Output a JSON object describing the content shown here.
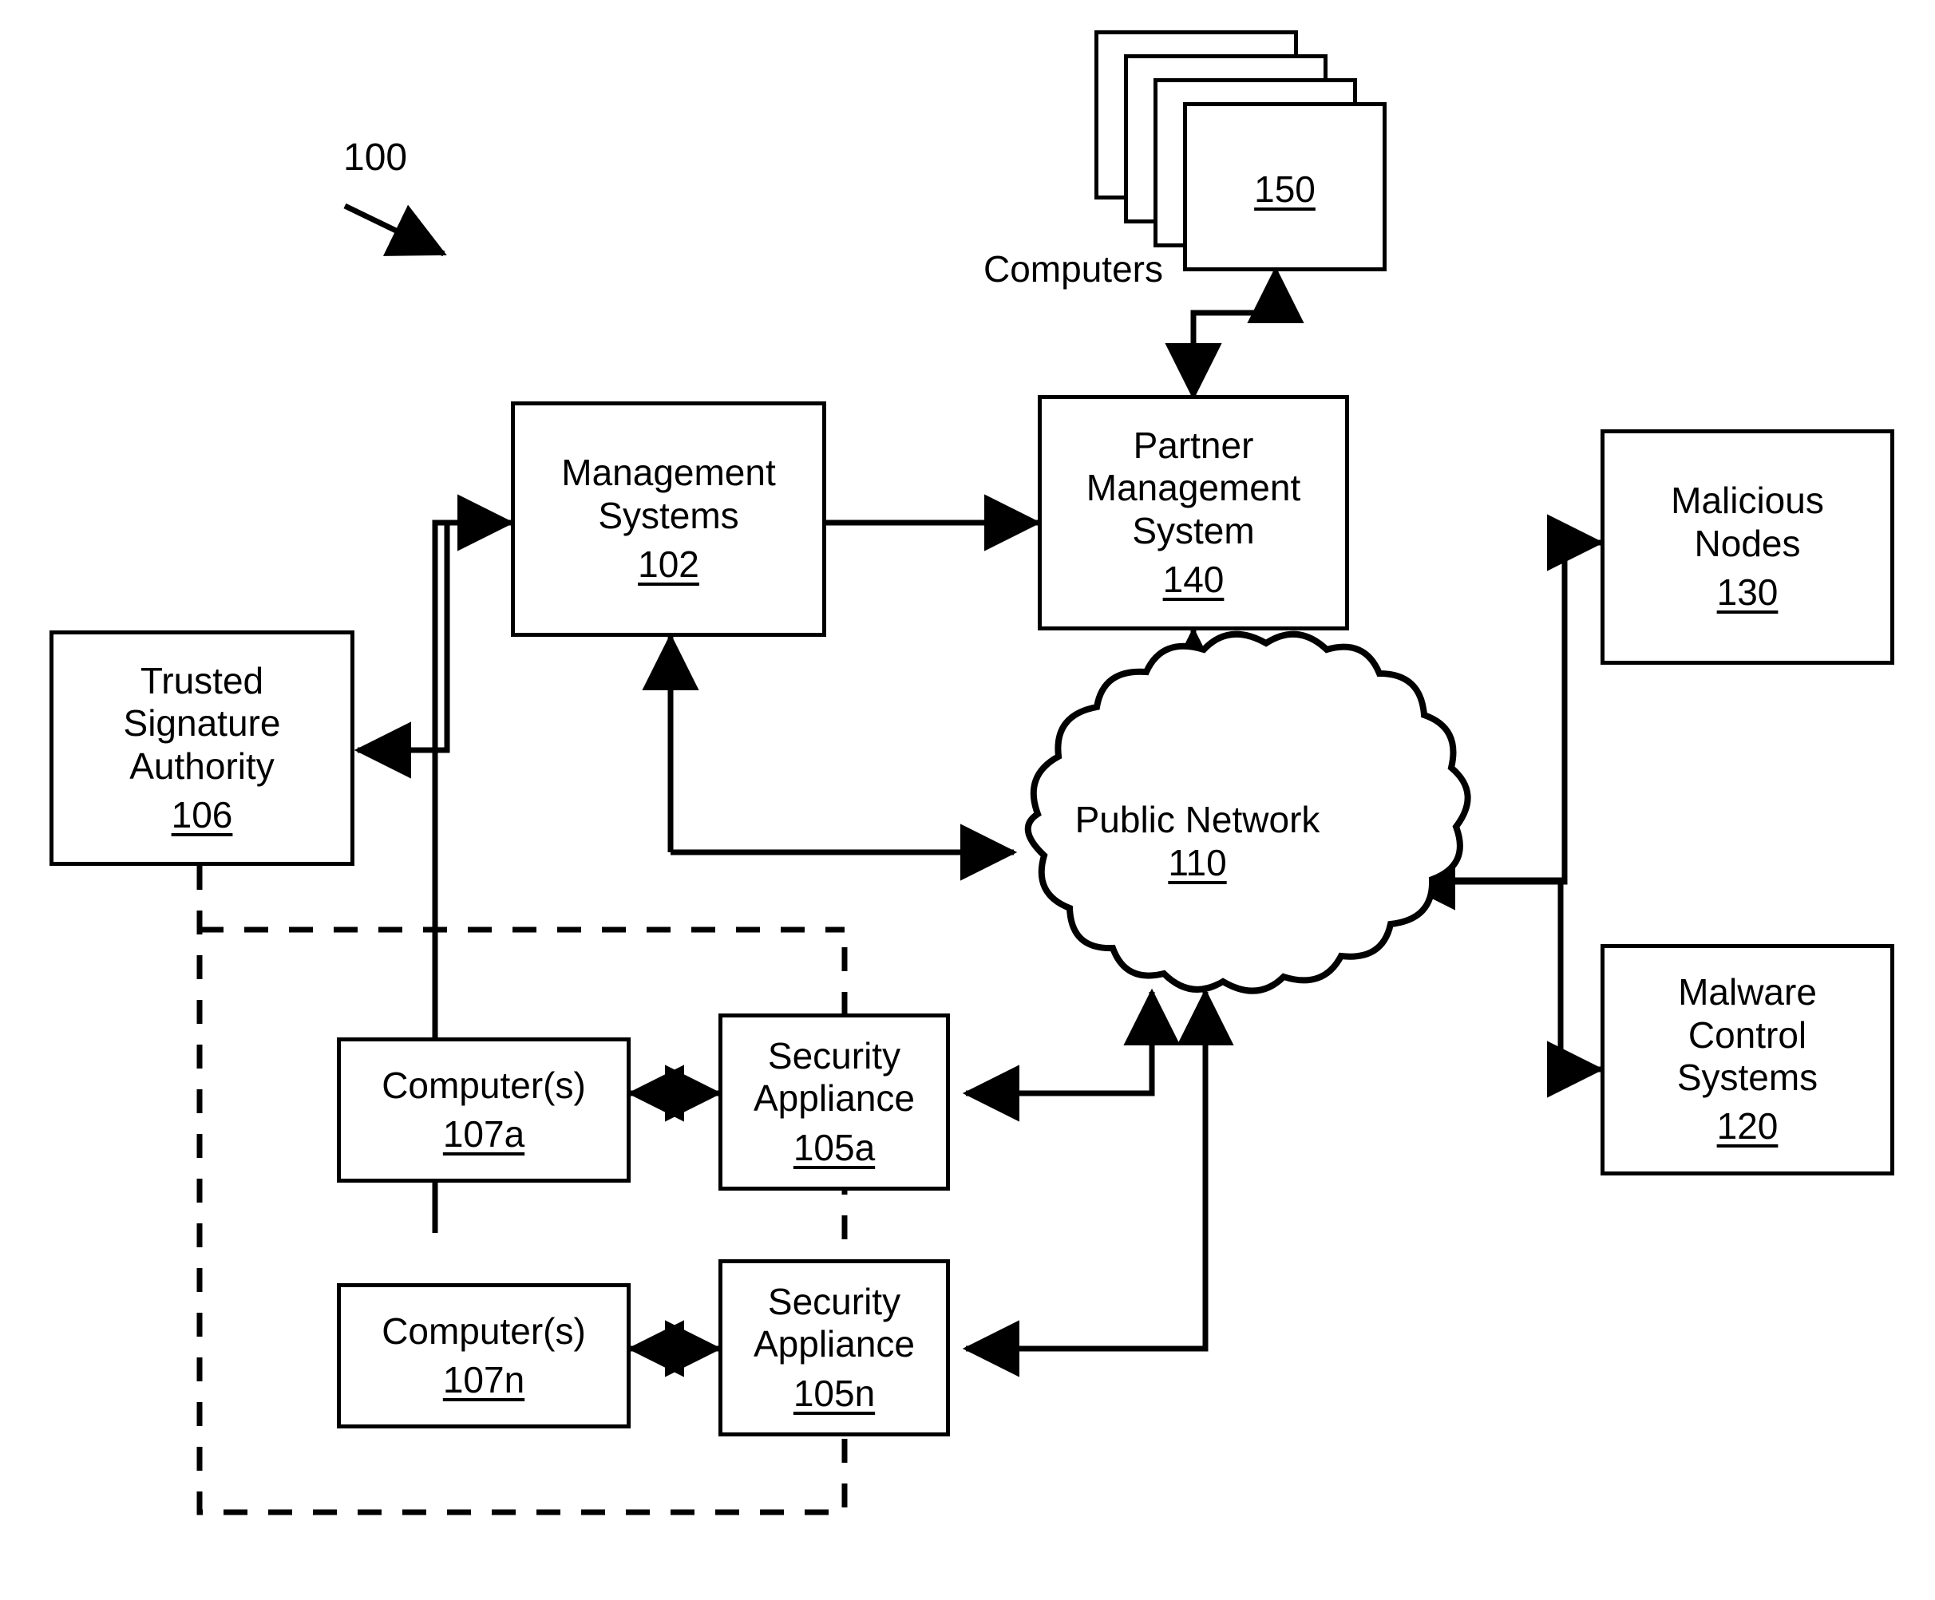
{
  "figure": {
    "figure_number": "100",
    "computers_caption": "Computers"
  },
  "nodes": {
    "computers_stack": {
      "ref": "150"
    },
    "management_systems": {
      "line1": "Management",
      "line2": "Systems",
      "ref": "102"
    },
    "partner_management_system": {
      "line1": "Partner",
      "line2": "Management",
      "line3": "System",
      "ref": "140"
    },
    "malicious_nodes": {
      "line1": "Malicious",
      "line2": "Nodes",
      "ref": "130"
    },
    "trusted_signature_authority": {
      "line1": "Trusted",
      "line2": "Signature",
      "line3": "Authority",
      "ref": "106"
    },
    "public_network": {
      "line1": "Public Network",
      "ref": "110"
    },
    "malware_control_systems": {
      "line1": "Malware",
      "line2": "Control",
      "line3": "Systems",
      "ref": "120"
    },
    "computers_a": {
      "line1": "Computer(s)",
      "ref": "107a"
    },
    "security_appliance_a": {
      "line1": "Security",
      "line2": "Appliance",
      "ref": "105a"
    },
    "computers_n": {
      "line1": "Computer(s)",
      "ref": "107n"
    },
    "security_appliance_n": {
      "line1": "Security",
      "line2": "Appliance",
      "ref": "105n"
    }
  },
  "colors": {
    "stroke": "#000000",
    "background": "#ffffff"
  },
  "chart_data": {
    "type": "diagram",
    "title": "Network security system block diagram 100",
    "blocks": [
      {
        "id": "150",
        "label": "Computers",
        "shape": "stacked-rectangle"
      },
      {
        "id": "102",
        "label": "Management Systems",
        "shape": "rectangle"
      },
      {
        "id": "140",
        "label": "Partner Management System",
        "shape": "rectangle"
      },
      {
        "id": "130",
        "label": "Malicious Nodes",
        "shape": "rectangle"
      },
      {
        "id": "106",
        "label": "Trusted Signature Authority",
        "shape": "rectangle"
      },
      {
        "id": "110",
        "label": "Public Network",
        "shape": "cloud"
      },
      {
        "id": "120",
        "label": "Malware Control Systems",
        "shape": "rectangle"
      },
      {
        "id": "107a",
        "label": "Computer(s)",
        "shape": "rectangle"
      },
      {
        "id": "105a",
        "label": "Security Appliance",
        "shape": "rectangle"
      },
      {
        "id": "107n",
        "label": "Computer(s)",
        "shape": "rectangle"
      },
      {
        "id": "105n",
        "label": "Security Appliance",
        "shape": "rectangle"
      }
    ],
    "edges": [
      {
        "from": "140",
        "to": "150",
        "type": "bidirectional"
      },
      {
        "from": "102",
        "to": "140",
        "type": "bidirectional"
      },
      {
        "from": "106",
        "to": "102",
        "type": "bidirectional"
      },
      {
        "from": "102",
        "to": "110",
        "type": "bidirectional"
      },
      {
        "from": "140",
        "to": "110",
        "type": "bidirectional"
      },
      {
        "from": "110",
        "to": "130",
        "type": "bidirectional"
      },
      {
        "from": "110",
        "to": "120",
        "type": "bidirectional"
      },
      {
        "from": "110",
        "to": "105a",
        "type": "bidirectional"
      },
      {
        "from": "110",
        "to": "105n",
        "type": "bidirectional"
      },
      {
        "from": "107a",
        "to": "105a",
        "type": "bidirectional"
      },
      {
        "from": "107n",
        "to": "105n",
        "type": "bidirectional"
      },
      {
        "from": "106",
        "to": "enterprise-boundary",
        "type": "dashed-boundary"
      }
    ]
  }
}
